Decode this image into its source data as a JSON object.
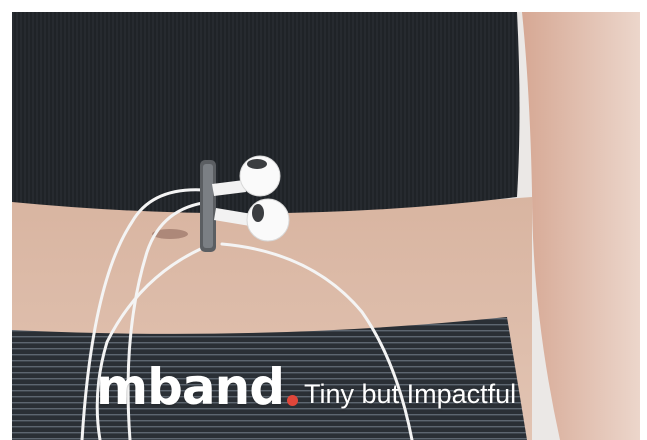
{
  "brand": {
    "logo_text": "mband",
    "tagline": "Tiny but Impactful",
    "dot_color": "#e0463a"
  },
  "photo": {
    "subject": "photograph",
    "top_color": "#1e2226",
    "skin_color": "#d9b9a6",
    "waistband_color": "#2b3036",
    "background_color": "#e9e6e3"
  }
}
